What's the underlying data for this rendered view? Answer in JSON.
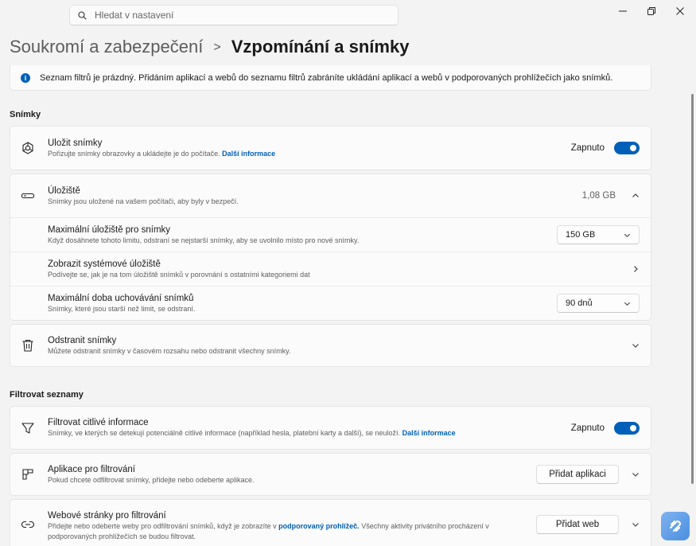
{
  "search": {
    "placeholder": "Hledat v nastavení"
  },
  "header": {
    "parent": "Soukromí a zabezpečení",
    "separator": ">",
    "current": "Vzpomínání a snímky"
  },
  "banner": {
    "text": "Seznam filtrů je prázdný. Přidáním aplikací a webů do seznamu filtrů zabráníte ukládání aplikací a webů v podporovaných prohlížečích jako snímků."
  },
  "sections": {
    "snapshots": "Snímky",
    "filters": "Filtrovat seznamy"
  },
  "save_snapshots": {
    "title": "Uložit snímky",
    "desc": "Pořizujte snímky obrazovky a ukládejte je do počítače.",
    "link": "Další informace",
    "toggle_label": "Zapnuto",
    "toggle_on": true
  },
  "storage": {
    "title": "Úložiště",
    "desc": "Snímky jsou uložené na vašem počítači, aby byly v bezpečí.",
    "value": "1,08 GB",
    "max_storage": {
      "title": "Maximální úložiště pro snímky",
      "desc": "Když dosáhnete tohoto limitu, odstraní se nejstarší snímky, aby se uvolnilo místo pro nové snímky.",
      "selected": "150 GB"
    },
    "system_storage": {
      "title": "Zobrazit systémové úložiště",
      "desc": "Podívejte se, jak je na tom úložiště snímků v porovnání s ostatními kategoriemi dat"
    },
    "retention": {
      "title": "Maximální doba uchovávání snímků",
      "desc": "Snímky, které jsou starší než limit, se odstraní.",
      "selected": "90 dnů"
    }
  },
  "delete_snapshots": {
    "title": "Odstranit snímky",
    "desc": "Můžete odstranit snímky v časovém rozsahu nebo odstranit všechny snímky."
  },
  "filter_sensitive": {
    "title": "Filtrovat citlivé informace",
    "desc": "Snímky, ve kterých se detekují potenciálně citlivé informace (například hesla, platební karty a další), se neuloží.",
    "link": "Další informace",
    "toggle_label": "Zapnuto",
    "toggle_on": true
  },
  "filter_apps": {
    "title": "Aplikace pro filtrování",
    "desc": "Pokud chcete odfiltrovat snímky, přidejte nebo odeberte aplikace.",
    "button": "Přidat aplikaci"
  },
  "filter_web": {
    "title": "Webové stránky pro filtrování",
    "desc_before": "Přidejte nebo odeberte weby pro odfiltrování snímků, když je zobrazíte v",
    "link": "podporovaný prohlížeč.",
    "desc_after": "Všechny aktivity privátního procházení v podporovaných prohlížečích se budou filtrovat.",
    "button": "Přidat web"
  },
  "colors": {
    "accent": "#005fb8",
    "background": "#f3f3f3",
    "card": "#fbfbfb"
  }
}
